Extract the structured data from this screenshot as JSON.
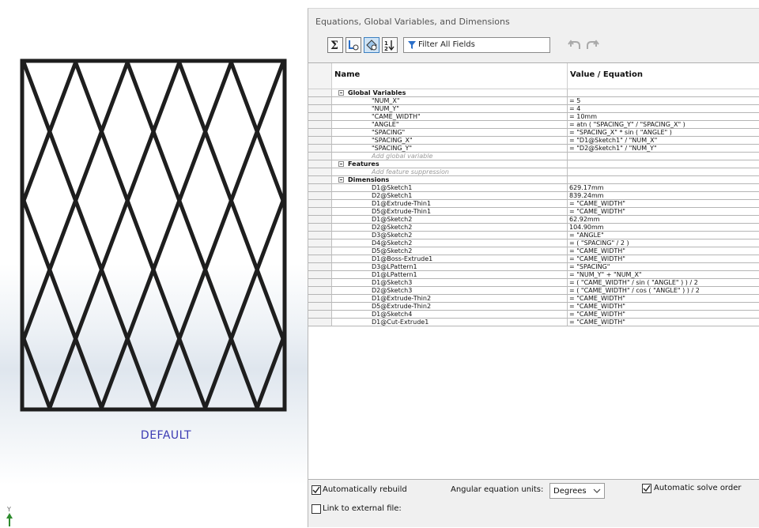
{
  "viewport": {
    "configuration_label": "DEFAULT",
    "triad_axis": "Y",
    "colors": {
      "frame": "#1e1e1e",
      "label": "#3b3bb3"
    }
  },
  "dialog": {
    "title": "Equations, Global Variables, and Dimensions",
    "toolbar": {
      "buttons": [
        {
          "icon": "equation-view-icon"
        },
        {
          "icon": "sketch-equation-view-icon"
        },
        {
          "icon": "dimension-view-icon"
        },
        {
          "icon": "ordered-view-icon"
        }
      ],
      "filter_placeholder": "Filter All Fields",
      "filter_icon": "funnel-icon",
      "undo_icon": "undo-icon",
      "redo_icon": "redo-icon"
    },
    "table": {
      "columns": {
        "name": "Name",
        "value": "Value / Equation"
      },
      "rows": [
        {
          "type": "section",
          "name": "Global Variables",
          "value": ""
        },
        {
          "type": "item",
          "name": "\"NUM_X\"",
          "value": "= 5"
        },
        {
          "type": "item",
          "name": "\"NUM_Y\"",
          "value": "= 4"
        },
        {
          "type": "item",
          "name": "\"CAME_WIDTH\"",
          "value": "= 10mm"
        },
        {
          "type": "item",
          "name": "\"ANGLE\"",
          "value": "= atn ( \"SPACING_Y\" / \"SPACING_X\" )"
        },
        {
          "type": "item",
          "name": "\"SPACING\"",
          "value": "= \"SPACING_X\" * sin ( \"ANGLE\" )"
        },
        {
          "type": "item",
          "name": "\"SPACING_X\"",
          "value": "= \"D1@Sketch1\" / \"NUM_X\""
        },
        {
          "type": "item",
          "name": "\"SPACING_Y\"",
          "value": "= \"D2@Sketch1\" / \"NUM_Y\""
        },
        {
          "type": "placeholder",
          "name": "Add global variable",
          "value": ""
        },
        {
          "type": "section",
          "name": "Features",
          "value": ""
        },
        {
          "type": "placeholder",
          "name": "Add feature suppression",
          "value": ""
        },
        {
          "type": "section",
          "name": "Dimensions",
          "value": ""
        },
        {
          "type": "item",
          "name": "D1@Sketch1",
          "value": "629.17mm"
        },
        {
          "type": "item",
          "name": "D2@Sketch1",
          "value": "839.24mm"
        },
        {
          "type": "item",
          "name": "D1@Extrude-Thin1",
          "value": "= \"CAME_WIDTH\""
        },
        {
          "type": "item",
          "name": "D5@Extrude-Thin1",
          "value": "= \"CAME_WIDTH\""
        },
        {
          "type": "item",
          "name": "D1@Sketch2",
          "value": "62.92mm"
        },
        {
          "type": "item",
          "name": "D2@Sketch2",
          "value": "104.90mm"
        },
        {
          "type": "item",
          "name": "D3@Sketch2",
          "value": "= \"ANGLE\""
        },
        {
          "type": "item",
          "name": "D4@Sketch2",
          "value": "= ( \"SPACING\" / 2 )"
        },
        {
          "type": "item",
          "name": "D5@Sketch2",
          "value": "= \"CAME_WIDTH\""
        },
        {
          "type": "item",
          "name": "D1@Boss-Extrude1",
          "value": "= \"CAME_WIDTH\""
        },
        {
          "type": "item",
          "name": "D3@LPattern1",
          "value": "= \"SPACING\""
        },
        {
          "type": "item",
          "name": "D1@LPattern1",
          "value": "= \"NUM_Y\" + \"NUM_X\""
        },
        {
          "type": "item",
          "name": "D1@Sketch3",
          "value": "= ( \"CAME_WIDTH\" / sin ( \"ANGLE\" ) ) / 2"
        },
        {
          "type": "item",
          "name": "D2@Sketch3",
          "value": "= ( \"CAME_WIDTH\" / cos ( \"ANGLE\" ) ) / 2"
        },
        {
          "type": "item",
          "name": "D1@Extrude-Thin2",
          "value": "= \"CAME_WIDTH\""
        },
        {
          "type": "item",
          "name": "D5@Extrude-Thin2",
          "value": "= \"CAME_WIDTH\""
        },
        {
          "type": "item",
          "name": "D1@Sketch4",
          "value": "= \"CAME_WIDTH\""
        },
        {
          "type": "item",
          "name": "D1@Cut-Extrude1",
          "value": "= \"CAME_WIDTH\""
        }
      ]
    },
    "options": {
      "auto_rebuild_label": "Automatically rebuild",
      "auto_rebuild_checked": true,
      "angular_units_label": "Angular equation units:",
      "angular_units_value": "Degrees",
      "auto_solve_label": "Automatic solve order",
      "auto_solve_checked": true,
      "link_external_label": "Link to external file:",
      "link_external_checked": false
    }
  }
}
